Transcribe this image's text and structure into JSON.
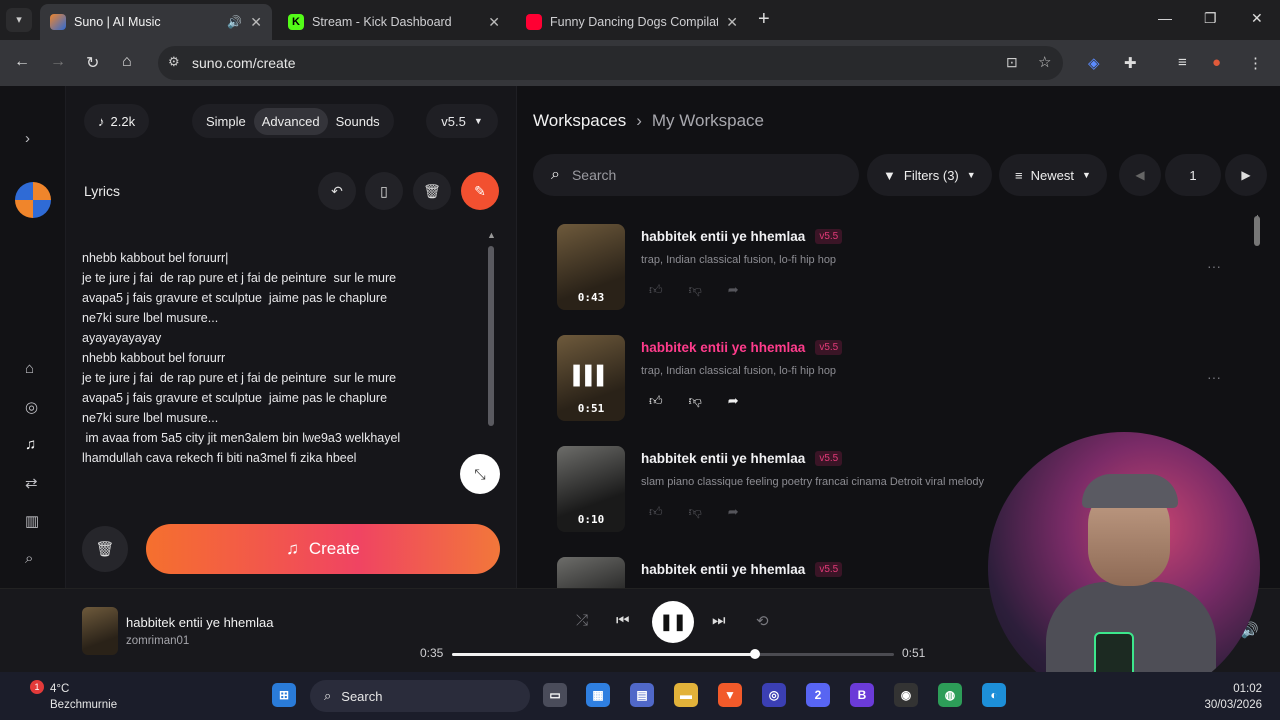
{
  "browser": {
    "tabs": [
      {
        "title": "Suno | AI Music",
        "active": true
      },
      {
        "title": "Stream - Kick Dashboard",
        "active": false
      },
      {
        "title": "Funny Dancing Dogs Compilati",
        "active": false
      }
    ],
    "url": "suno.com/create"
  },
  "top": {
    "credits": "2.2k",
    "modes": [
      "Simple",
      "Advanced",
      "Sounds"
    ],
    "version": "v5.5"
  },
  "lyrics": {
    "label": "Lyrics",
    "text": "nhebb kabbout bel foruurr|\nje te jure j fai  de rap pure et j fai de peinture  sur le mure\navapa5 j fais gravure et sculptue  jaime pas le chaplure\nne7ki sure lbel musure...\nayayayayayay\nnhebb kabbout bel foruurr\nje te jure j fai  de rap pure et j fai de peinture  sur le mure\navapa5 j fais gravure et sculptue  jaime pas le chaplure\nne7ki sure lbel musure...\n im avaa from 5a5 city jit men3alem bin lwe9a3 welkhayel\nlhamdullah cava rekech fi biti na3mel fi zika hbeel"
  },
  "create_label": "Create",
  "workspace": {
    "root": "Workspaces",
    "current": "My Workspace",
    "search_placeholder": "Search",
    "filters": "Filters (3)",
    "sort": "Newest",
    "page": "1"
  },
  "songs": [
    {
      "title": "habbitek entii ye hhemlaa",
      "version": "v5.5",
      "tags": "trap, Indian classical fusion, lo-fi hip hop",
      "duration": "0:43",
      "playing": false
    },
    {
      "title": "habbitek entii ye hhemlaa",
      "version": "v5.5",
      "tags": "trap, Indian classical fusion, lo-fi hip hop",
      "duration": "0:51",
      "playing": true
    },
    {
      "title": "habbitek entii ye hhemlaa",
      "version": "v5.5",
      "tags": "slam piano classique feeling poetry francai cinama Detroit viral melody",
      "duration": "0:10",
      "playing": false
    },
    {
      "title": "habbitek entii ye hhemlaa",
      "version": "v5.5",
      "tags": "",
      "duration": "",
      "playing": false
    }
  ],
  "player": {
    "title": "habbitek entii ye hhemlaa",
    "artist": "zomriman01",
    "elapsed": "0:35",
    "total": "0:51",
    "progress": 0.686
  },
  "taskbar": {
    "temp": "4°C",
    "location": "Bezchmurnie",
    "search": "Search",
    "time": "01:02",
    "date": "30/03/2026",
    "notif": "1",
    "discord_badge": "2"
  },
  "colors": {
    "accent": "#f25030",
    "pink": "#ff3c8c"
  }
}
